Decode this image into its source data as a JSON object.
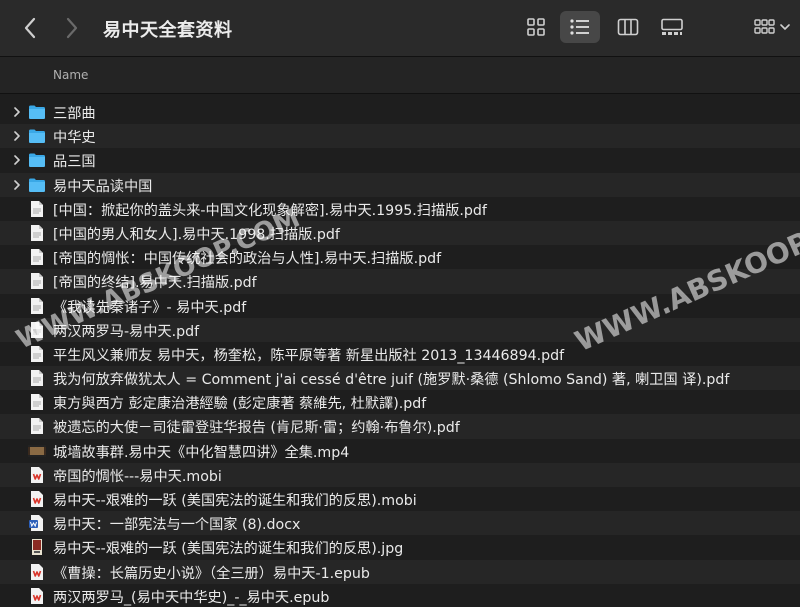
{
  "toolbar": {
    "title": "易中天全套资料",
    "views": [
      "icon",
      "list",
      "column",
      "gallery",
      "group"
    ]
  },
  "header": {
    "name_label": "Name"
  },
  "files": [
    {
      "name": "三部曲",
      "type": "folder"
    },
    {
      "name": "中华史",
      "type": "folder"
    },
    {
      "name": "品三国",
      "type": "folder"
    },
    {
      "name": "易中天品读中国",
      "type": "folder"
    },
    {
      "name": "[中国：掀起你的盖头来-中国文化现象解密].易中天.1995.扫描版.pdf",
      "type": "pdf"
    },
    {
      "name": "[中国的男人和女人].易中天.1998.扫描版.pdf",
      "type": "pdf"
    },
    {
      "name": "[帝国的惆怅：中国传统社会的政治与人性].易中天.扫描版.pdf",
      "type": "pdf"
    },
    {
      "name": "[帝国的终结].易中天.扫描版.pdf",
      "type": "pdf"
    },
    {
      "name": "《我读先秦诸子》- 易中天.pdf",
      "type": "pdf"
    },
    {
      "name": "两汉两罗马-易中天.pdf",
      "type": "pdf"
    },
    {
      "name": "平生风义兼师友 易中天，杨奎松，陈平原等著 新星出版社 2013_13446894.pdf",
      "type": "pdf"
    },
    {
      "name": "我为何放弃做犹太人 = Comment j'ai cessé d'être juif (施罗默·桑德 (Shlomo Sand) 著, 喇卫国 译).pdf",
      "type": "pdf"
    },
    {
      "name": "東方與西方 彭定康治港經驗 (彭定康著 蔡維先, 杜默譯).pdf",
      "type": "pdf"
    },
    {
      "name": "被遗忘的大使－司徒雷登驻华报告 (肯尼斯·雷；约翰·布鲁尔).pdf",
      "type": "pdf"
    },
    {
      "name": "城墙故事群.易中天《中化智慧四讲》全集.mp4",
      "type": "video"
    },
    {
      "name": "帝国的惆怅---易中天.mobi",
      "type": "mobi"
    },
    {
      "name": "易中天--艰难的一跃 (美国宪法的诞生和我们的反思).mobi",
      "type": "mobi"
    },
    {
      "name": "易中天：一部宪法与一个国家 (8).docx",
      "type": "docx"
    },
    {
      "name": "易中天--艰难的一跃 (美国宪法的诞生和我们的反思).jpg",
      "type": "jpg"
    },
    {
      "name": "《曹操：长篇历史小说》（全三册）易中天-1.epub",
      "type": "epub"
    },
    {
      "name": "两汉两罗马_(易中天中华史)_-_易中天.epub",
      "type": "epub"
    }
  ],
  "watermarks": [
    "WWW.ABSKOOP.COM",
    "WWW.ABSKOOP.COM"
  ]
}
